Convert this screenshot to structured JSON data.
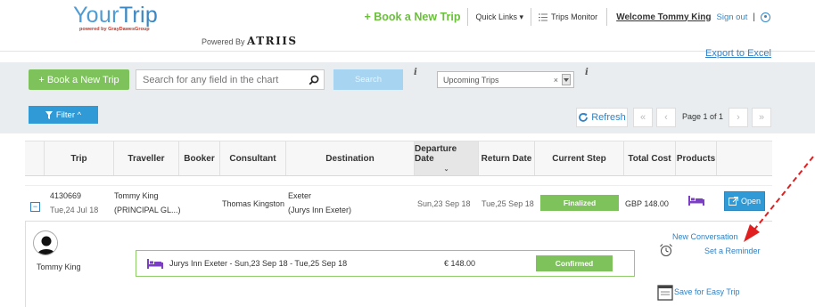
{
  "brand": {
    "logo_main": "Your",
    "logo_accent": "Trip",
    "logo_sub": "powered by GrayDawesGroup",
    "powered_by": "Powered By",
    "powered_brand": "ATRIIS"
  },
  "top_nav": {
    "book_label": "+ Book a New Trip",
    "quick_links": "Quick Links ▾",
    "trips_monitor": "Trips Monitor",
    "welcome": "Welcome Tommy King",
    "sign_out": "Sign out",
    "pipe": "|"
  },
  "export_label": "Export to Excel",
  "toolbar": {
    "book_label": "+ Book a New Trip",
    "search_placeholder": "Search for any field in the chart",
    "search_button": "Search",
    "info_icon": "i",
    "filter_value": "Upcoming Trips",
    "filter_clear": "×",
    "filter_button": "Filter ^",
    "refresh_label": "Refresh",
    "first_page": "«",
    "prev_page": "‹",
    "page_label": "Page 1 of 1",
    "next_page": "›",
    "last_page": "»"
  },
  "table": {
    "columns": [
      "Trip",
      "Traveller",
      "Booker",
      "Consultant",
      "Destination",
      "Departure Date",
      "Return Date",
      "Current Step",
      "Total Cost",
      "Products"
    ],
    "sorted_caret": "⌄",
    "row": {
      "trip_id": "4130669",
      "trip_date": "Tue,24 Jul 18",
      "traveller": "Tommy King",
      "traveller_org": "(PRINCIPAL GL...)",
      "consultant": "Thomas Kingston",
      "destination": "Exeter",
      "destination_detail": "(Jurys Inn Exeter)",
      "departure": "Sun,23 Sep 18",
      "return": "Tue,25 Sep 18",
      "step": "Finalized",
      "cost": "GBP 148.00",
      "product_icon": "hotel-bed-icon",
      "open_label": "Open",
      "expand_symbol": "−"
    }
  },
  "detail": {
    "traveller_name": "Tommy King",
    "segment_text": "Jurys Inn Exeter - Sun,23 Sep 18 - Tue,25 Sep 18",
    "segment_price": "€ 148.00",
    "segment_status": "Confirmed",
    "new_conversation": "New Conversation",
    "set_reminder": "Set a Reminder",
    "save_easy_trip": "Save for Easy Trip"
  },
  "colors": {
    "green": "#7dc25b",
    "blue": "#2f9ad6",
    "link_blue": "#2f82c6",
    "annotation_red": "#e02020",
    "hotel_purple": "#7b3fc4"
  }
}
